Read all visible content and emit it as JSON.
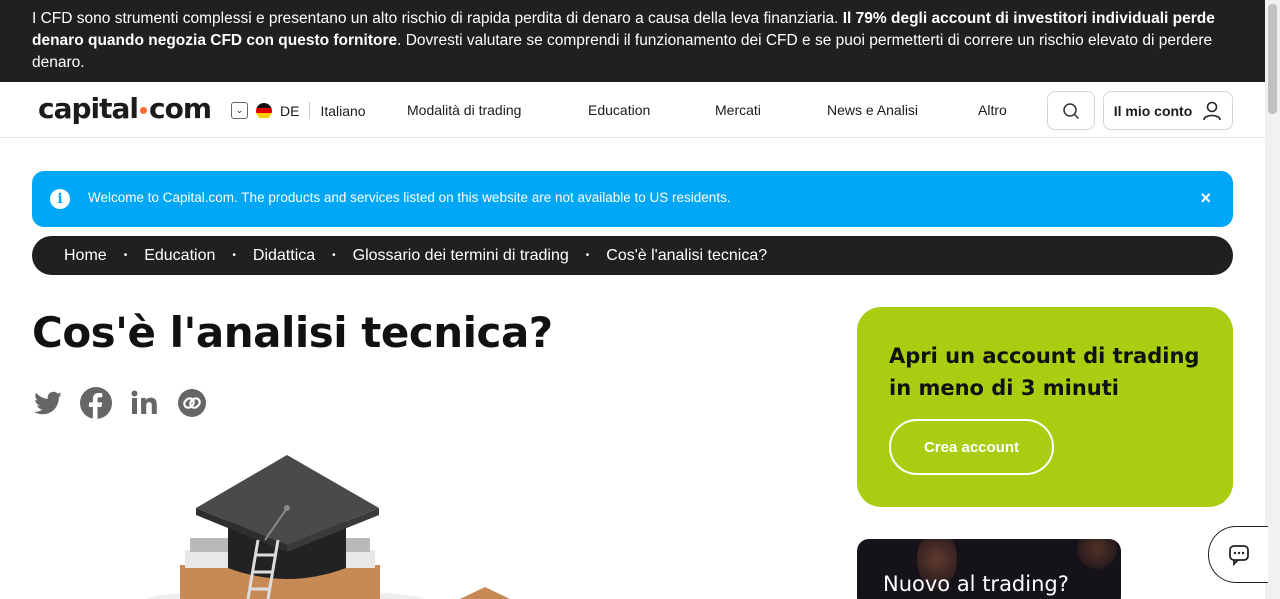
{
  "risk_banner": {
    "text_before": "I CFD sono strumenti complessi e presentano un alto rischio di rapida perdita di denaro a causa della leva finanziaria. ",
    "text_bold": "Il 79% degli account di investitori individuali perde denaro quando negozia CFD con questo fornitore",
    "text_after": ". Dovresti valutare se comprendi il funzionamento dei CFD e se puoi permetterti di correre un rischio elevato di perdere denaro."
  },
  "header": {
    "logo_left": "capital",
    "logo_right": "com",
    "country_code": "DE",
    "language": "Italiano",
    "nav": [
      "Modalità di trading",
      "Education",
      "Mercati",
      "News e Analisi",
      "Altro"
    ],
    "account_label": "Il mio conto"
  },
  "welcome": {
    "text": "Welcome to Capital.com. The products and services listed on this website are not available to US residents.",
    "close": "×"
  },
  "breadcrumb": [
    "Home",
    "Education",
    "Didattica",
    "Glossario dei termini di trading",
    "Cos'è l'analisi tecnica?"
  ],
  "breadcrumb_separator": "•",
  "article": {
    "title": "Cos'è l'analisi tecnica?"
  },
  "share_icons": [
    "twitter-icon",
    "facebook-icon",
    "linkedin-icon",
    "link-icon"
  ],
  "cta_card": {
    "title": "Apri un account di trading in meno di 3 minuti",
    "button": "Crea account",
    "color": "#a8cd11"
  },
  "promo_card": {
    "title": "Nuovo al trading?"
  },
  "colors": {
    "accent_blue": "#00a7f7",
    "dark": "#202020",
    "logo_dot": "#ff6b2b"
  }
}
